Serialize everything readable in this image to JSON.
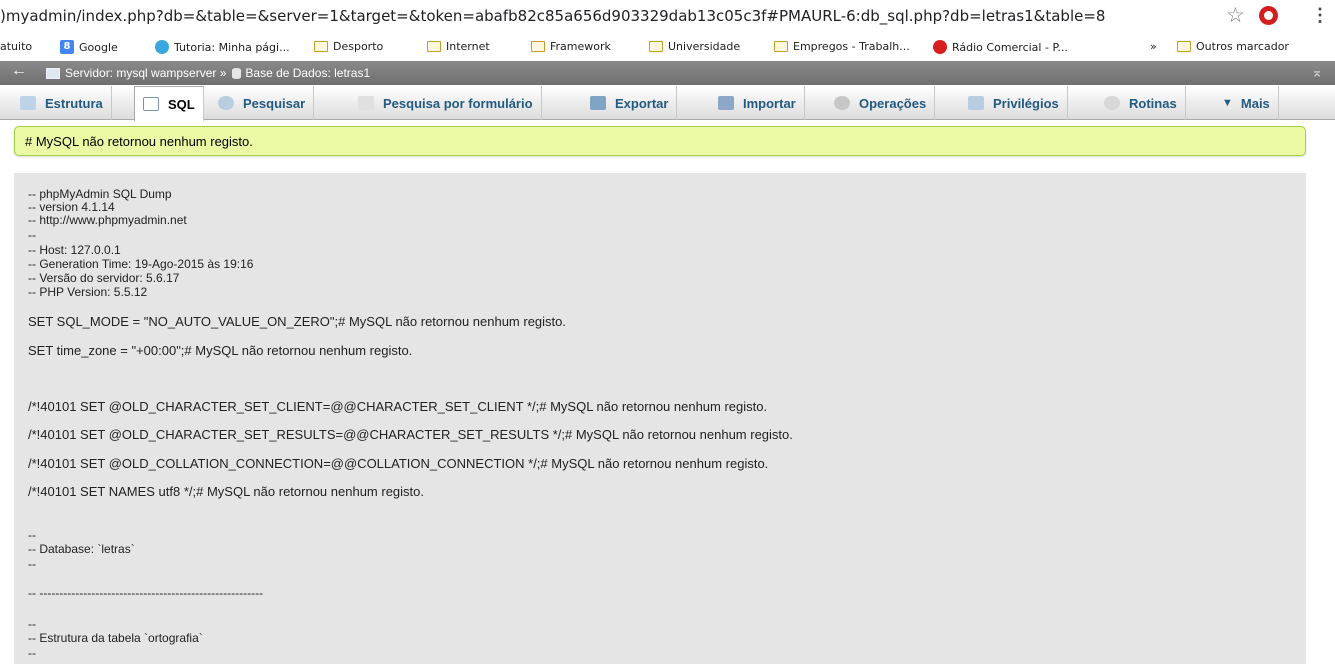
{
  "browser": {
    "url": ")myadmin/index.php?db=&table=&server=1&target=&token=abafb82c85a656d903329dab13c05c3f#PMAURL-6:db_sql.php?db=letras1&table=8",
    "bookmarks": [
      "atuito",
      "Google",
      "Tutoria: Minha pági...",
      "Desporto",
      "Internet",
      "Framework",
      "Universidade",
      "Empregos - Trabalh...",
      "Rádio Comercial - P...",
      "»",
      "Outros marcador"
    ]
  },
  "breadcrumb": {
    "server": "Servidor: mysql wampserver »",
    "database": "Base de Dados: letras1"
  },
  "tabs": [
    "Estrutura",
    "SQL",
    "Pesquisar",
    "Pesquisa por formulário",
    "Exportar",
    "Importar",
    "Operações",
    "Privilégios",
    "Rotinas",
    "Mais"
  ],
  "message": "# MySQL não retornou nenhum registo.",
  "dump": {
    "header": [
      "-- phpMyAdmin SQL Dump",
      "-- version 4.1.14",
      "-- http://www.phpmyadmin.net",
      "--",
      "-- Host: 127.0.0.1",
      "-- Generation Time: 19-Ago-2015 às 19:16",
      "-- Versão do servidor: 5.6.17",
      "-- PHP Version: 5.5.12"
    ],
    "statements": [
      "SET SQL_MODE = \"NO_AUTO_VALUE_ON_ZERO\";# MySQL não retornou nenhum registo.",
      "SET time_zone = \"+00:00\";# MySQL não retornou nenhum registo.",
      "/*!40101 SET @OLD_CHARACTER_SET_CLIENT=@@CHARACTER_SET_CLIENT */;# MySQL não retornou nenhum registo.",
      "/*!40101 SET @OLD_CHARACTER_SET_RESULTS=@@CHARACTER_SET_RESULTS */;# MySQL não retornou nenhum registo.",
      "/*!40101 SET @OLD_COLLATION_CONNECTION=@@COLLATION_CONNECTION */;# MySQL não retornou nenhum registo.",
      "/*!40101 SET NAMES utf8 */;# MySQL não retornou nenhum registo."
    ],
    "database_block": [
      "--",
      "-- Database: `letras`",
      "--"
    ],
    "separator": "-- --------------------------------------------------------",
    "table_block": [
      "--",
      "-- Estrutura da tabela `ortografia`",
      "--"
    ]
  }
}
